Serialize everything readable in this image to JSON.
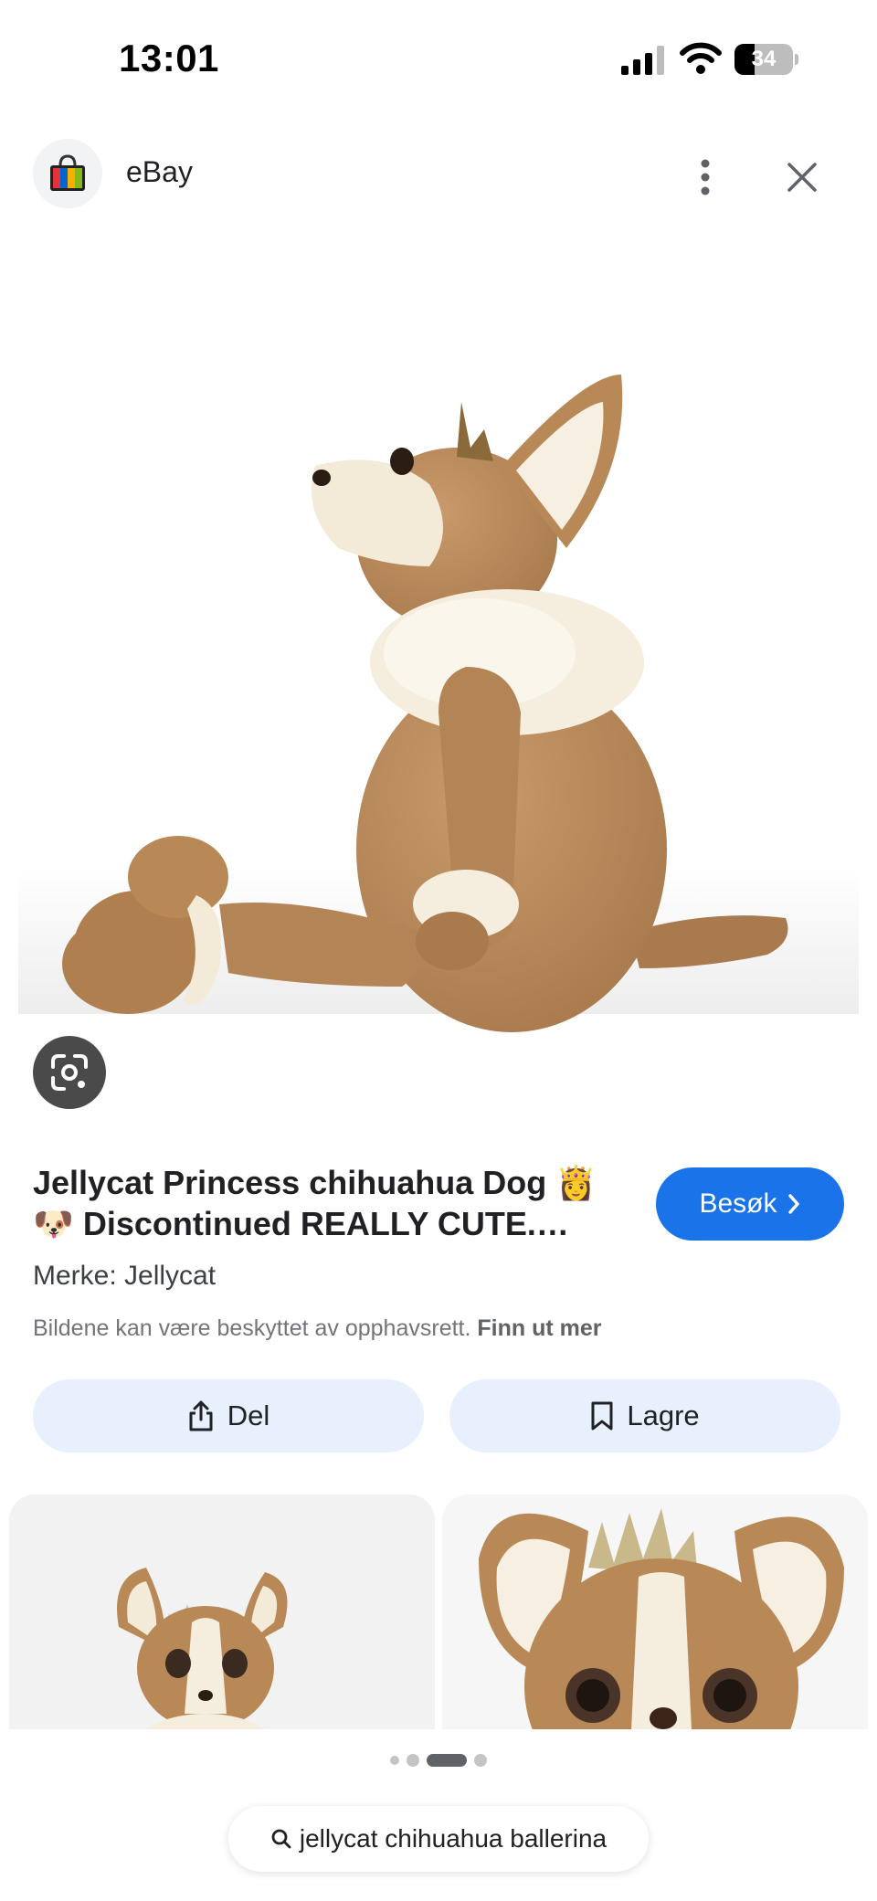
{
  "status_bar": {
    "time": "13:01",
    "battery": "34",
    "battery_level": 0.34,
    "signal_icon": "cellular-signal-icon",
    "wifi_icon": "wifi-icon"
  },
  "header": {
    "site_name": "eBay",
    "logo_icon": "ebay-shopping-bag-icon",
    "more_icon": "more-vertical-icon",
    "close_icon": "close-icon"
  },
  "main_image": {
    "subject": "plush-chihuahua-image",
    "lens_icon": "google-lens-icon"
  },
  "product": {
    "title": "Jellycat Princess chihuahua Dog 👸 🐶 Discontinued REALLY CUTE. With...",
    "visit_label": "Besøk",
    "brand": "Merke: Jellycat",
    "copyright_text": "Bildene kan være beskyttet av opphavsrett.",
    "learn_more": "Finn ut mer"
  },
  "actions": {
    "share_label": "Del",
    "save_label": "Lagre"
  },
  "pager": {
    "count": 4,
    "active_index": 2
  },
  "search": {
    "query": "jellycat chihuahua ballerina"
  },
  "colors": {
    "accent": "#1a73e8",
    "action_bg": "#e8f0fe",
    "plush_fur": "#b98a5e",
    "plush_cream": "#f3ead8"
  }
}
